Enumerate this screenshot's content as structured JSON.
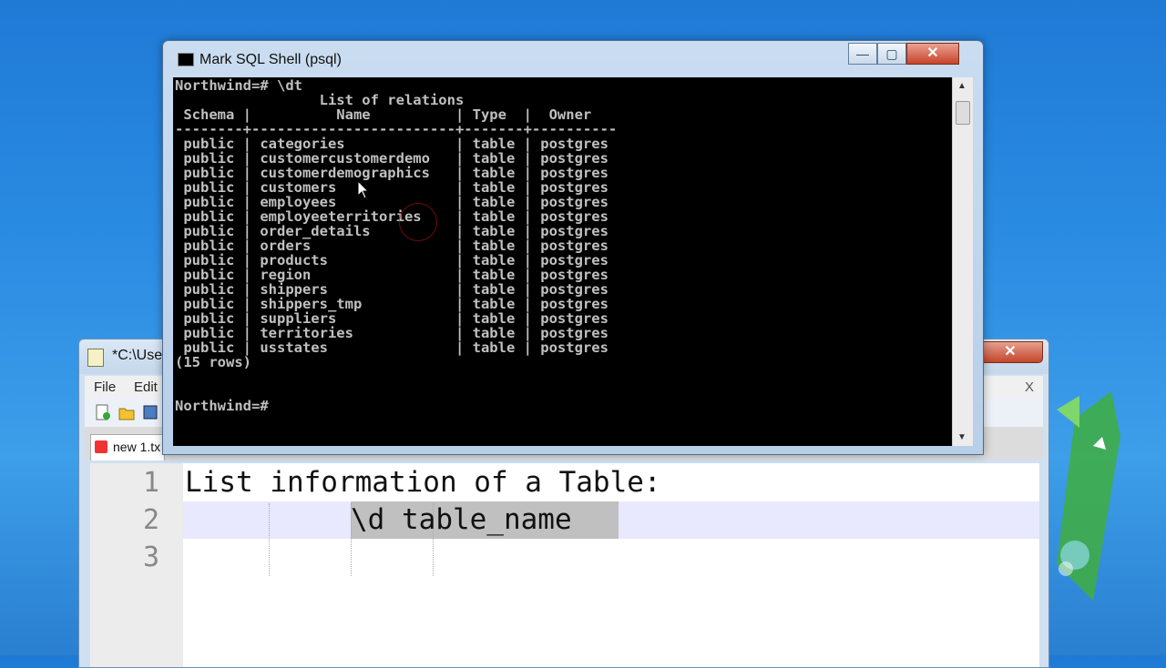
{
  "notepad": {
    "title": "*C:\\Use",
    "close": "✕",
    "menu": {
      "file": "File",
      "edit": "Edit",
      "close_doc": "X",
      "more": "»"
    },
    "tab": {
      "label": "new 1.tx"
    },
    "lines": [
      {
        "num": "1",
        "text": "List information of a Table:"
      },
      {
        "num": "2",
        "text": "\\d table_name"
      },
      {
        "num": "3",
        "text": ""
      }
    ]
  },
  "psql": {
    "title": "Mark SQL Shell (psql)",
    "buttons": {
      "minimize": "—",
      "maximize": "▢",
      "close": "✕"
    },
    "console_text": "Northwind=# \\dt\n                 List of relations\n Schema |          Name          | Type  |  Owner\n--------+------------------------+-------+----------\n public | categories             | table | postgres\n public | customercustomerdemo   | table | postgres\n public | customerdemographics   | table | postgres\n public | customers              | table | postgres\n public | employees              | table | postgres\n public | employeeterritories    | table | postgres\n public | order_details          | table | postgres\n public | orders                 | table | postgres\n public | products               | table | postgres\n public | region                 | table | postgres\n public | shippers               | table | postgres\n public | shippers_tmp           | table | postgres\n public | suppliers              | table | postgres\n public | territories            | table | postgres\n public | usstates               | table | postgres\n(15 rows)\n\n\nNorthwind=#"
  }
}
